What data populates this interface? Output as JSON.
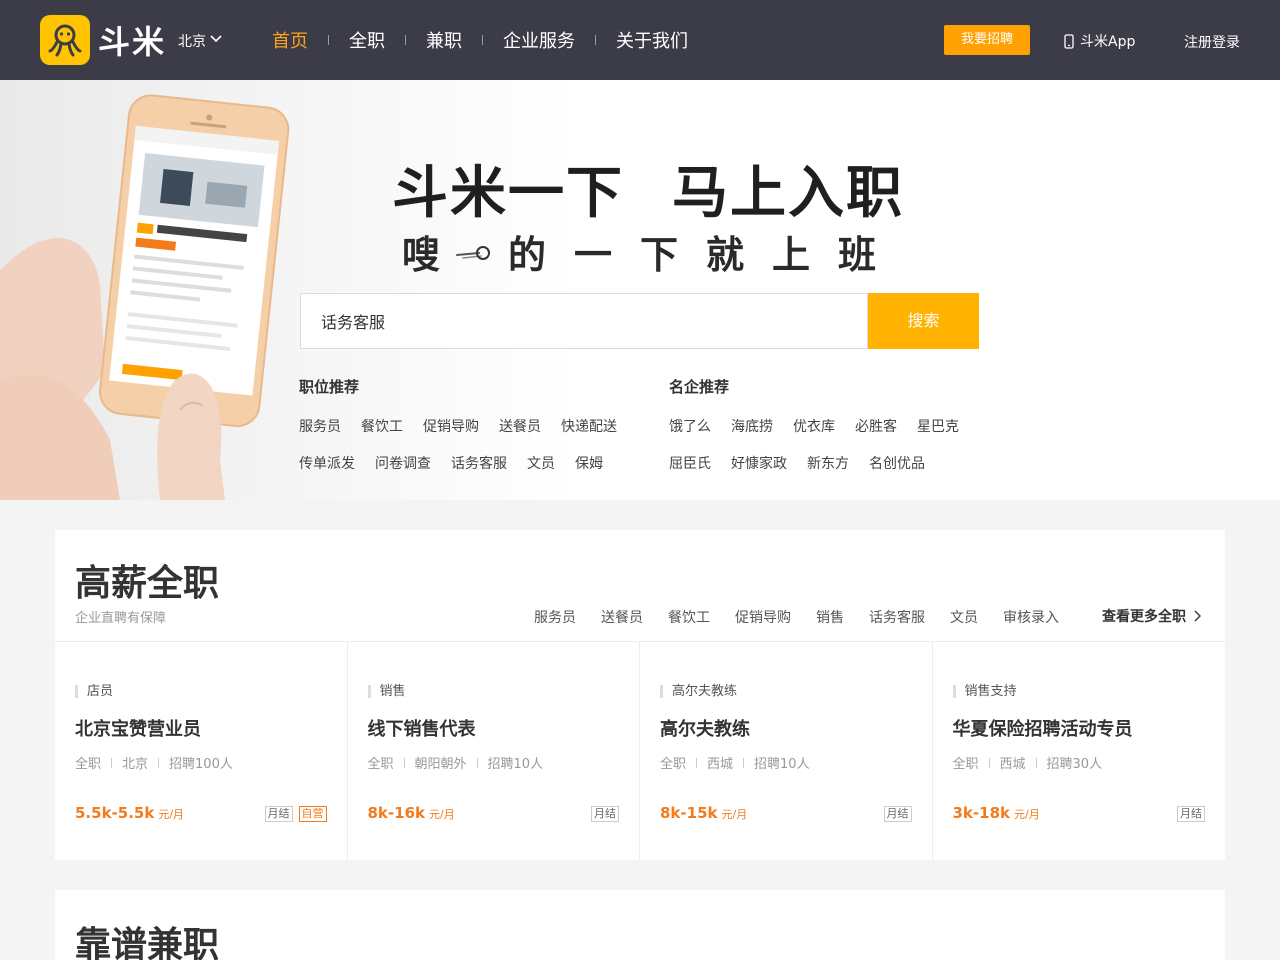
{
  "header": {
    "logo_text": "斗米",
    "city": "北京",
    "nav": [
      {
        "label": "首页",
        "active": true
      },
      {
        "label": "全职"
      },
      {
        "label": "兼职"
      },
      {
        "label": "企业服务"
      },
      {
        "label": "关于我们"
      }
    ],
    "hire_button": "我要招聘",
    "app_link": "斗米App",
    "login": "注册登录"
  },
  "hero": {
    "slogan_left": "斗米一下",
    "slogan_right": "马上入职",
    "subslogan_a": "嗖",
    "subslogan_b": "的一下就上班",
    "search_value": "话务客服",
    "search_button": "搜索",
    "job_rec_title": "职位推荐",
    "job_rec_row1": [
      "服务员",
      "餐饮工",
      "促销导购",
      "送餐员",
      "快递配送"
    ],
    "job_rec_row2": [
      "传单派发",
      "问卷调查",
      "话务客服",
      "文员",
      "保姆"
    ],
    "company_rec_title": "名企推荐",
    "company_rec_row1": [
      "饿了么",
      "海底捞",
      "优衣库",
      "必胜客",
      "星巴克"
    ],
    "company_rec_row2": [
      "屈臣氏",
      "好慷家政",
      "新东方",
      "名创优品"
    ]
  },
  "fulltime": {
    "title": "高薪全职",
    "subtitle": "企业直聘有保障",
    "tags": [
      "服务员",
      "送餐员",
      "餐饮工",
      "促销导购",
      "销售",
      "话务客服",
      "文员",
      "审核录入"
    ],
    "more": "查看更多全职",
    "jobs": [
      {
        "category": "店员",
        "title": "北京宝赞营业员",
        "meta": [
          "全职",
          "北京",
          "招聘100人"
        ],
        "pay": "5.5k-5.5k",
        "unit": "元/月",
        "badges": [
          "月结",
          "自营"
        ]
      },
      {
        "category": "销售",
        "title": "线下销售代表",
        "meta": [
          "全职",
          "朝阳朝外",
          "招聘10人"
        ],
        "pay": "8k-16k",
        "unit": "元/月",
        "badges": [
          "月结"
        ]
      },
      {
        "category": "高尔夫教练",
        "title": "高尔夫教练",
        "meta": [
          "全职",
          "西城",
          "招聘10人"
        ],
        "pay": "8k-15k",
        "unit": "元/月",
        "badges": [
          "月结"
        ]
      },
      {
        "category": "销售支持",
        "title": "华夏保险招聘活动专员",
        "meta": [
          "全职",
          "西城",
          "招聘30人"
        ],
        "pay": "3k-18k",
        "unit": "元/月",
        "badges": [
          "月结"
        ]
      }
    ]
  },
  "parttime": {
    "title": "靠谱兼职"
  },
  "colors": {
    "header_bg": "#3b3c48",
    "accent": "#ffa21e",
    "search_button": "#ffb300",
    "pay": "#f27b1b"
  }
}
